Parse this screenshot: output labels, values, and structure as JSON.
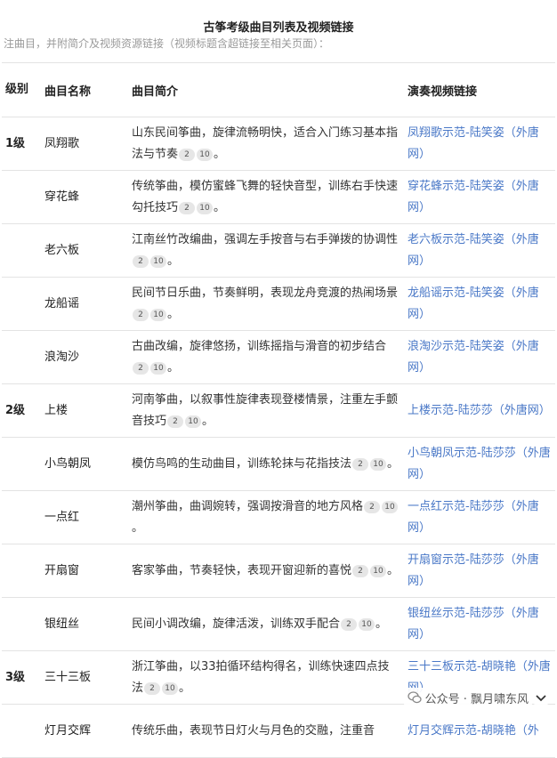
{
  "page": {
    "title": "古筝考级曲目列表及视频链接",
    "cut_line": "注曲目，并附简介及视频资源链接（视频标题含超链接至相关页面）："
  },
  "table": {
    "headers": {
      "level": "级别",
      "name": "曲目名称",
      "desc": "曲目简介",
      "link": "演奏视频链接"
    },
    "rows": [
      {
        "level": "1级",
        "name": "凤翔歌",
        "desc": "山东民间筝曲，旋律流畅明快，适合入门练习基本指法与节奏",
        "refs": [
          "2",
          "10"
        ],
        "tail": "。",
        "link": "凤翔歌示范-陆笑姿（外唐网）"
      },
      {
        "level": "",
        "name": "穿花蜂",
        "desc": "传统筝曲，模仿蜜蜂飞舞的轻快音型，训练右手快速勾托技巧",
        "refs": [
          "2",
          "10"
        ],
        "tail": "。",
        "link": "穿花蜂示范-陆笑姿（外唐网）"
      },
      {
        "level": "",
        "name": "老六板",
        "desc": "江南丝竹改编曲，强调左手按音与右手弹拨的协调性",
        "refs": [
          "2",
          "10"
        ],
        "tail": "。",
        "link": "老六板示范-陆笑姿（外唐网）"
      },
      {
        "level": "",
        "name": "龙船谣",
        "desc": "民间节日乐曲，节奏鲜明，表现龙舟竞渡的热闹场景",
        "refs": [
          "2",
          "10"
        ],
        "tail": "。",
        "link": "龙船谣示范-陆笑姿（外唐网）"
      },
      {
        "level": "",
        "name": "浪淘沙",
        "desc": "古曲改编，旋律悠扬，训练摇指与滑音的初步结合",
        "refs": [
          "2",
          "10"
        ],
        "tail": "。",
        "link": "浪淘沙示范-陆笑姿（外唐网）"
      },
      {
        "level": "2级",
        "name": "上楼",
        "desc": "河南筝曲，以叙事性旋律表现登楼情景，注重左手颤音技巧",
        "refs": [
          "2",
          "10"
        ],
        "tail": "。",
        "link": "上楼示范-陆莎莎（外唐网）"
      },
      {
        "level": "",
        "name": "小鸟朝凤",
        "desc": "模仿鸟鸣的生动曲目，训练轮抹与花指技法",
        "refs": [
          "2",
          "10"
        ],
        "tail": "。",
        "link": "小鸟朝凤示范-陆莎莎（外唐网）"
      },
      {
        "level": "",
        "name": "一点红",
        "desc": "潮州筝曲，曲调婉转，强调按滑音的地方风格",
        "refs": [
          "2",
          "10"
        ],
        "tail": "。",
        "link": "一点红示范-陆莎莎（外唐网）"
      },
      {
        "level": "",
        "name": "开扇窗",
        "desc": "客家筝曲，节奏轻快，表现开窗迎新的喜悦",
        "refs": [
          "2",
          "10"
        ],
        "tail": "。",
        "link": "开扇窗示范-陆莎莎（外唐网）"
      },
      {
        "level": "",
        "name": "银纽丝",
        "desc": "民间小调改编，旋律活泼，训练双手配合",
        "refs": [
          "2",
          "10"
        ],
        "tail": "。",
        "link": "银纽丝示范-陆莎莎（外唐网）"
      },
      {
        "level": "3级",
        "name": "三十三板",
        "desc": "浙江筝曲，以33拍循环结构得名，训练快速四点技法",
        "refs": [
          "2",
          "10"
        ],
        "tail": "。",
        "link": "三十三板示范-胡晓艳（外唐网）"
      },
      {
        "level": "",
        "name": "灯月交辉",
        "desc": "传统乐曲，表现节日灯火与月色的交融，注重音",
        "refs": [],
        "tail": "",
        "link": "灯月交辉示范-胡晓艳（外"
      }
    ]
  },
  "watermark": {
    "text": "公众号 · 飘月啸东风",
    "icon": "wechat-icon"
  },
  "scroll_button": {
    "icon": "chevron-down-icon"
  }
}
